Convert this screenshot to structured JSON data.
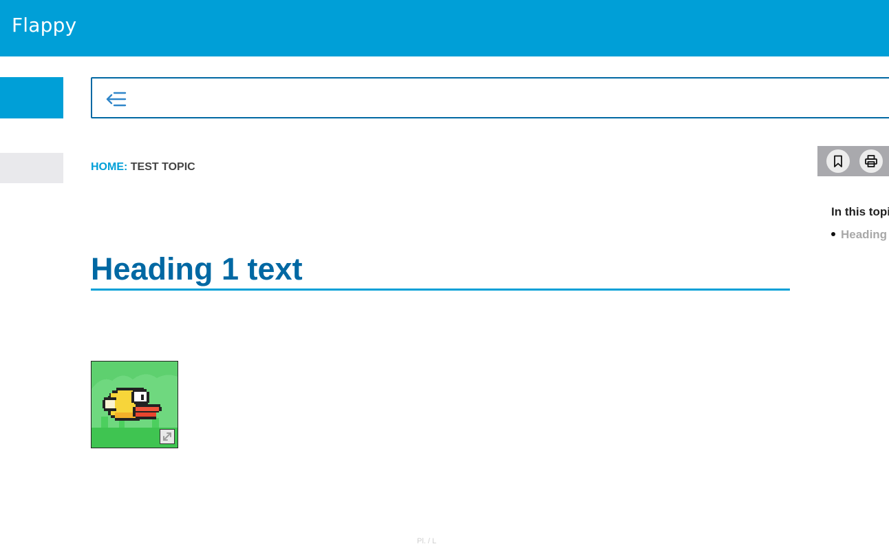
{
  "header": {
    "app_title": "Flappy",
    "background_color": "#009fd7"
  },
  "search": {
    "toggle_icon": "collapse-toc-icon",
    "placeholder": ""
  },
  "breadcrumb": {
    "home_label": "HOME:",
    "current_label": "TEST TOPIC"
  },
  "main": {
    "heading": "Heading 1 text",
    "heading_color": "#0068a3",
    "image_alt": "Flappy bird",
    "expand_icon": "expand-icon"
  },
  "toolbar": {
    "bookmark_icon": "bookmark-icon",
    "print_icon": "print-icon"
  },
  "toc_panel": {
    "title": "In this topi",
    "items": [
      {
        "label": "Heading"
      }
    ]
  },
  "footer": {
    "text": "Pl. / L"
  }
}
